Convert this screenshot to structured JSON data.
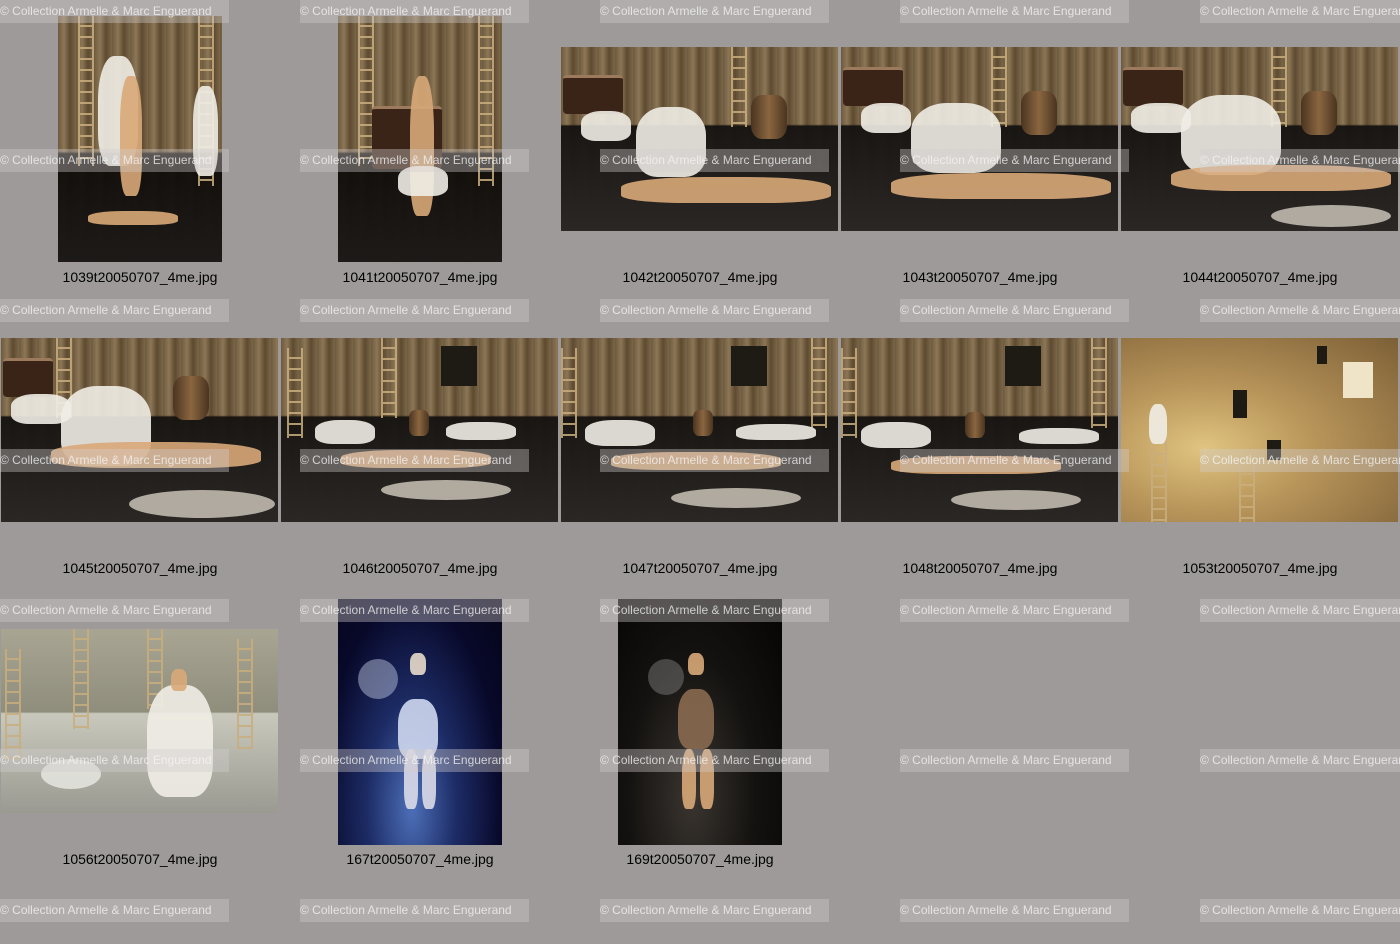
{
  "contact_sheet": {
    "watermark_text": "© Collection Armelle & Marc Enguerand",
    "background_color": "#9e9a9a",
    "thumbnails": [
      {
        "filename": "1039t20050707_4me.jpg",
        "scene": "stage-warm"
      },
      {
        "filename": "1041t20050707_4me.jpg",
        "scene": "stage-warm"
      },
      {
        "filename": "1042t20050707_4me.jpg",
        "scene": "stage-warm"
      },
      {
        "filename": "1043t20050707_4me.jpg",
        "scene": "stage-warm"
      },
      {
        "filename": "1044t20050707_4me.jpg",
        "scene": "stage-warm"
      },
      {
        "filename": "1045t20050707_4me.jpg",
        "scene": "stage-warm"
      },
      {
        "filename": "1046t20050707_4me.jpg",
        "scene": "stage-warm"
      },
      {
        "filename": "1047t20050707_4me.jpg",
        "scene": "stage-warm"
      },
      {
        "filename": "1048t20050707_4me.jpg",
        "scene": "stage-warm"
      },
      {
        "filename": "1053t20050707_4me.jpg",
        "scene": "wall-gold"
      },
      {
        "filename": "1056t20050707_4me.jpg",
        "scene": "stage-pale"
      },
      {
        "filename": "167t20050707_4me.jpg",
        "scene": "stage-blue"
      },
      {
        "filename": "169t20050707_4me.jpg",
        "scene": "stage-dark"
      }
    ]
  }
}
